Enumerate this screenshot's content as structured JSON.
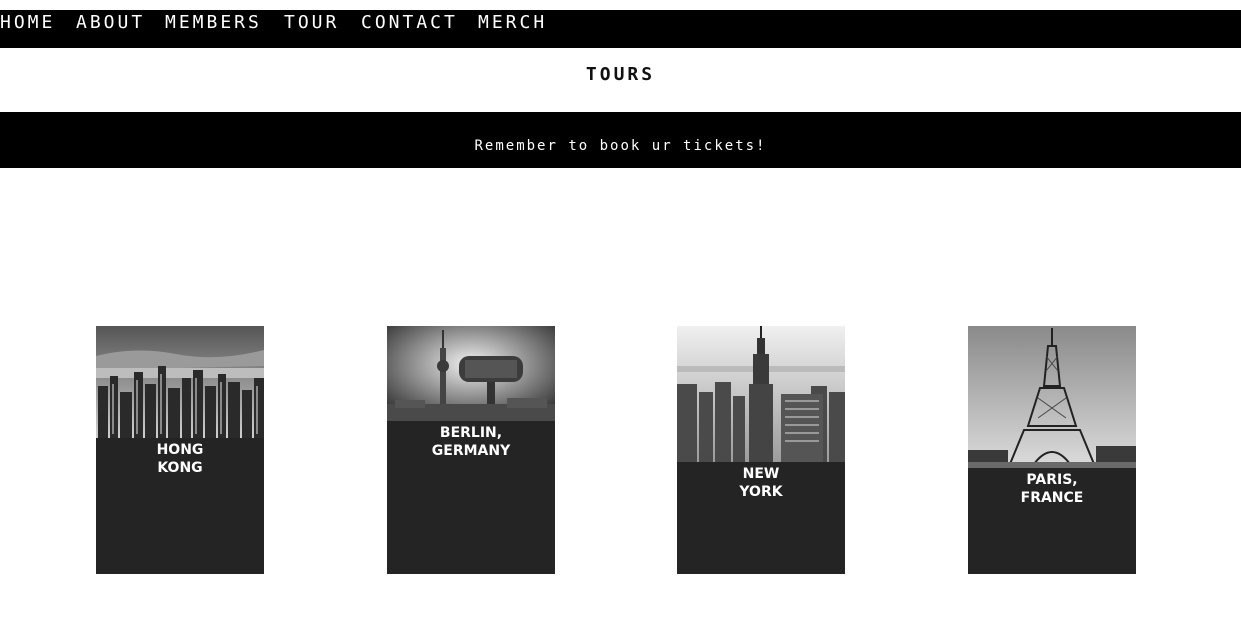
{
  "nav": {
    "items": [
      {
        "label": "HOME"
      },
      {
        "label": "ABOUT"
      },
      {
        "label": "MEMBERS"
      },
      {
        "label": "TOUR"
      },
      {
        "label": "CONTACT"
      },
      {
        "label": "MERCH"
      }
    ]
  },
  "page": {
    "title": "TOURS"
  },
  "banner": {
    "text": "Remember to book ur tickets!"
  },
  "tours": [
    {
      "city": "HONG\nKONG",
      "image": "hong-kong-skyline"
    },
    {
      "city": "BERLIN,\nGERMANY",
      "image": "berlin-tv-tower"
    },
    {
      "city": "NEW\nYORK",
      "image": "new-york-empire-state"
    },
    {
      "city": "PARIS,\nFRANCE",
      "image": "paris-eiffel-tower"
    }
  ],
  "colors": {
    "nav_bg": "#000000",
    "banner_bg": "#000000",
    "card_bg": "#242424",
    "text_light": "#ffffff"
  }
}
